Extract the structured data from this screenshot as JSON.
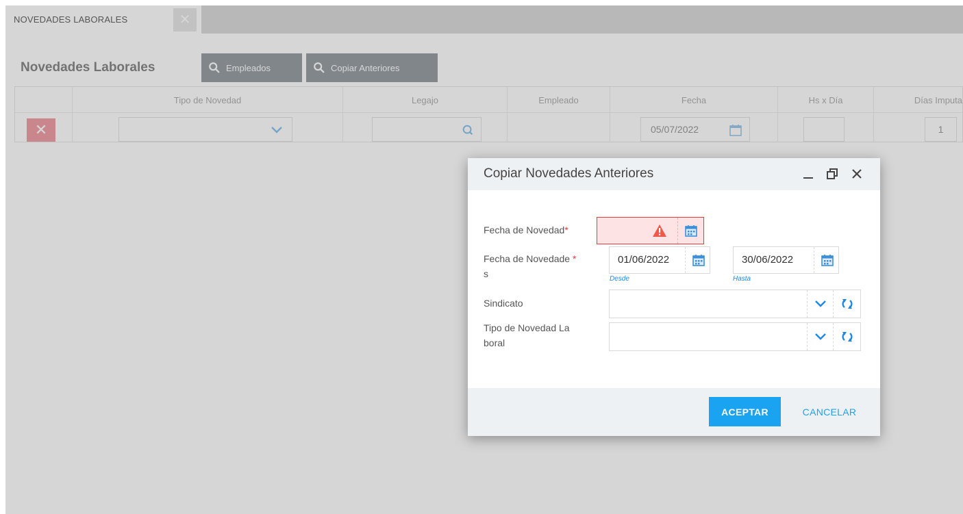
{
  "tabs": [
    {
      "label": "NOVEDADES LABORALES"
    }
  ],
  "page": {
    "title": "Novedades Laborales",
    "buttons": {
      "empleados": "Empleados",
      "copiar": "Copiar Anteriores"
    }
  },
  "grid": {
    "columns": [
      "Tipo de Novedad",
      "Legajo",
      "Empleado",
      "Fecha",
      "Hs x Día",
      "Días Imputa"
    ],
    "row": {
      "fecha": "05/07/2022",
      "dias": "1"
    }
  },
  "dialog": {
    "title": "Copiar Novedades Anteriores",
    "fields": {
      "fecha_novedad": {
        "label": "Fecha de Novedad",
        "required_mark": "*",
        "value": ""
      },
      "fecha_novedades": {
        "label_line1": "Fecha de Novedade",
        "label_line2": "s",
        "required_mark": "*",
        "desde": "01/06/2022",
        "hasta": "30/06/2022",
        "desde_hint": "Desde",
        "hasta_hint": "Hasta"
      },
      "sindicato": {
        "label": "Sindicato",
        "value": ""
      },
      "tipo_novedad": {
        "label_line1": "Tipo de Novedad La",
        "label_line2": "boral",
        "value": ""
      }
    },
    "buttons": {
      "accept": "ACEPTAR",
      "cancel": "CANCELAR"
    }
  },
  "colors": {
    "accent": "#1aa3f0",
    "error": "#e53935",
    "calendar": "#3b8fd9"
  },
  "icons": [
    "close-icon",
    "search-icon",
    "chevron-down-icon",
    "calendar-icon",
    "warning-icon",
    "refresh-icon",
    "minimize-icon",
    "restore-icon"
  ]
}
